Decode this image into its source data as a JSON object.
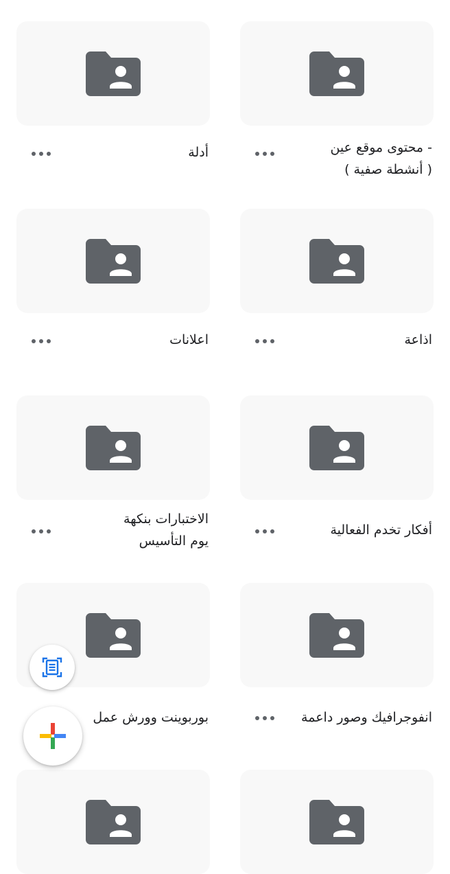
{
  "folders": [
    {
      "name": "- محتوى موقع عين\n( أنشطة صفية )",
      "icon": "shared-folder-icon"
    },
    {
      "name": "أدلة",
      "icon": "shared-folder-icon"
    },
    {
      "name": "اذاعة",
      "icon": "shared-folder-icon"
    },
    {
      "name": "اعلانات",
      "icon": "shared-folder-icon"
    },
    {
      "name": "أفكار تخدم الفعالية",
      "icon": "shared-folder-icon"
    },
    {
      "name": "الاختبارات بنكهة\nيوم التأسيس",
      "icon": "shared-folder-icon"
    },
    {
      "name": "انفوجرافيك وصور داعمة",
      "icon": "shared-folder-icon"
    },
    {
      "name": "بوربوينت وورش عمل",
      "icon": "shared-folder-icon"
    },
    {
      "name": "",
      "icon": "shared-folder-icon"
    },
    {
      "name": "",
      "icon": "shared-folder-icon"
    }
  ],
  "fab": {
    "scan_icon": "document-scan-icon",
    "new_icon": "plus-icon"
  },
  "colors": {
    "folder_icon": "#5f6368",
    "card_bg": "#f8f8f8",
    "text": "#202124",
    "plus_red": "#ea4335",
    "plus_yellow": "#fbbc04",
    "plus_green": "#34a853",
    "plus_blue": "#4285f4",
    "scan_blue": "#1a73e8"
  }
}
